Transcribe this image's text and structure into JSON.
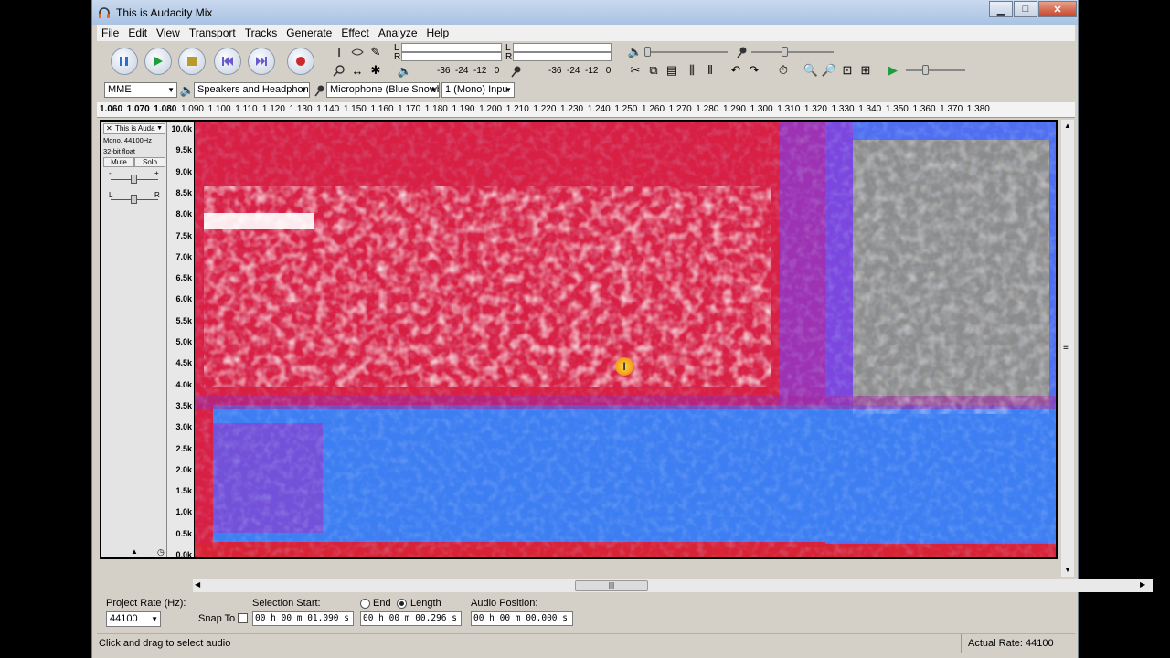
{
  "window": {
    "title": "This is Audacity Mix",
    "controls": {
      "minimize": "▁",
      "maximize": "□",
      "close": "✕"
    }
  },
  "menu": [
    "File",
    "Edit",
    "View",
    "Transport",
    "Tracks",
    "Generate",
    "Effect",
    "Analyze",
    "Help"
  ],
  "transport": [
    "pause",
    "play",
    "stop",
    "skip-start",
    "skip-end",
    "record"
  ],
  "meters": {
    "play_letters": {
      "L": "L",
      "R": "R"
    },
    "rec_letters": {
      "L": "L",
      "R": "R"
    },
    "play_ticks": "-36  -24  -12   0",
    "rec_ticks": "-36  -24  -12   0"
  },
  "devices": {
    "host": "MME",
    "output": "Speakers and Headphon",
    "input": "Microphone (Blue Snowb",
    "channels": "1 (Mono) Inpu"
  },
  "ruler": {
    "ticks": [
      "1.060",
      "1.070",
      "1.080",
      "1.090",
      "1.100",
      "1.110",
      "1.120",
      "1.130",
      "1.140",
      "1.150",
      "1.160",
      "1.170",
      "1.180",
      "1.190",
      "1.200",
      "1.210",
      "1.220",
      "1.230",
      "1.240",
      "1.250",
      "1.260",
      "1.270",
      "1.280",
      "1.290",
      "1.300",
      "1.310",
      "1.320",
      "1.330",
      "1.340",
      "1.350",
      "1.360",
      "1.370",
      "1.380"
    ]
  },
  "track": {
    "name": "This is Auda",
    "info1": "Mono, 44100Hz",
    "info2": "32-bit float",
    "mute": "Mute",
    "solo": "Solo",
    "gain_minus": "-",
    "gain_plus": "+",
    "pan_left": "L",
    "pan_right": "R",
    "close": "✕"
  },
  "freq_axis": [
    "10.0k",
    "9.5k",
    "9.0k",
    "8.5k",
    "8.0k",
    "7.5k",
    "7.0k",
    "6.5k",
    "6.0k",
    "5.5k",
    "5.0k",
    "4.5k",
    "4.0k",
    "3.5k",
    "3.0k",
    "2.5k",
    "2.0k",
    "1.5k",
    "1.0k",
    "0.5k",
    "0.0k"
  ],
  "selection": {
    "project_rate_label": "Project Rate (Hz):",
    "project_rate": "44100",
    "snap_to": "Snap To",
    "selection_start_label": "Selection Start:",
    "end_label": "End",
    "length_label": "Length",
    "audio_position_label": "Audio Position:",
    "start_value": "00 h 00 m 01.090 s",
    "length_value": "00 h 00 m 00.296 s",
    "audio_position_value": "00 h 00 m 00.000 s"
  },
  "status": {
    "left": "Click and drag to select audio",
    "right": "Actual Rate: 44100"
  },
  "scroll_handle": "|||",
  "colors": {
    "accent_red": "#d8203a",
    "accent_blue": "#3a7ff0",
    "accent_gray": "#8c8c8c"
  }
}
